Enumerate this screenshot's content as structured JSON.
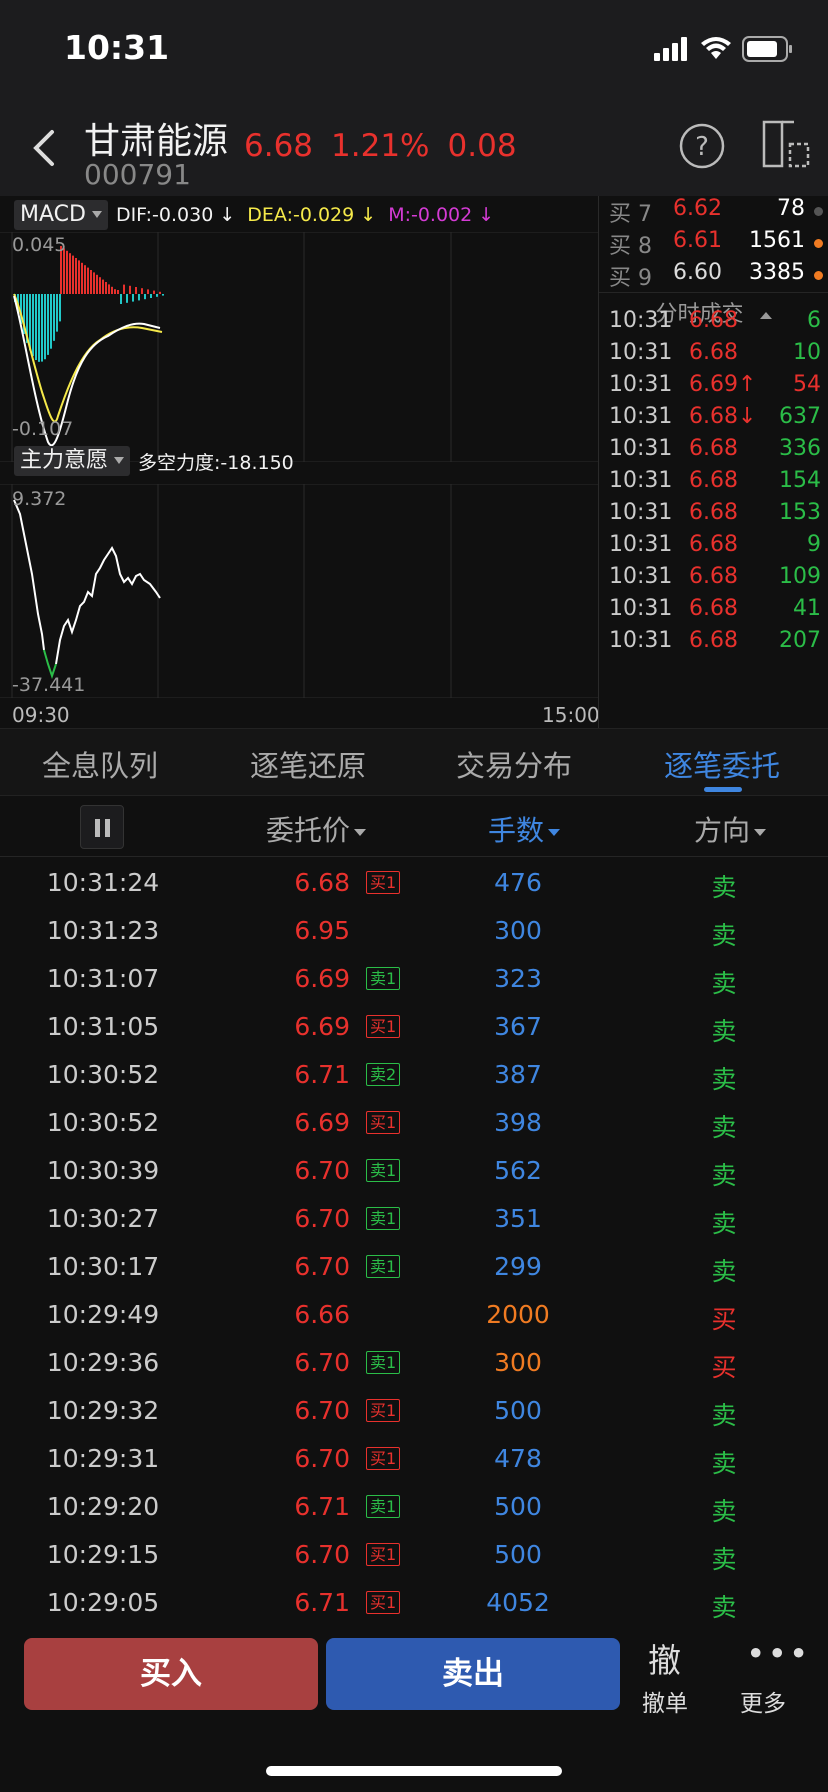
{
  "status": {
    "time": "10:31"
  },
  "header": {
    "name": "甘肃能源",
    "code": "000791",
    "price": "6.68",
    "change_pct": "1.21%",
    "change": "0.08"
  },
  "macd": {
    "selector": "MACD",
    "dif": "DIF:-0.030 ↓",
    "dea": "DEA:-0.029 ↓",
    "m": "M:-0.002 ↓",
    "top": "0.045",
    "bottom": "-0.107",
    "colors": {
      "dif": "#ffffff",
      "dea": "#f5e94a",
      "m": "#d43bd4",
      "up": "#e8312d",
      "down": "#22c8c8"
    }
  },
  "power": {
    "selector": "主力意愿",
    "label": "多空力度:-18.150",
    "top": "9.372",
    "bottom": "-37.441"
  },
  "time_axis": {
    "start": "09:30",
    "end": "15:00"
  },
  "orderbook": {
    "rows": [
      {
        "label": "买 7",
        "price": "6.62",
        "vol": "78",
        "price_color": "#e8312d",
        "dot": "#555555"
      },
      {
        "label": "买 8",
        "price": "6.61",
        "vol": "1561",
        "price_color": "#e8312d",
        "dot": "#f07b22"
      },
      {
        "label": "买 9",
        "price": "6.60",
        "vol": "3385",
        "price_color": "#dddddd",
        "dot": "#f07b22"
      }
    ],
    "ticks_title": "分时成交",
    "ticks": [
      {
        "time": "10:31",
        "price": "6.68",
        "vol": "6",
        "vol_color": "#2bbd48"
      },
      {
        "time": "10:31",
        "price": "6.68",
        "vol": "10",
        "vol_color": "#2bbd48"
      },
      {
        "time": "10:31",
        "price": "6.69↑",
        "vol": "54",
        "vol_color": "#e8312d"
      },
      {
        "time": "10:31",
        "price": "6.68↓",
        "vol": "637",
        "vol_color": "#2bbd48"
      },
      {
        "time": "10:31",
        "price": "6.68",
        "vol": "336",
        "vol_color": "#2bbd48"
      },
      {
        "time": "10:31",
        "price": "6.68",
        "vol": "154",
        "vol_color": "#2bbd48"
      },
      {
        "time": "10:31",
        "price": "6.68",
        "vol": "153",
        "vol_color": "#2bbd48"
      },
      {
        "time": "10:31",
        "price": "6.68",
        "vol": "9",
        "vol_color": "#2bbd48"
      },
      {
        "time": "10:31",
        "price": "6.68",
        "vol": "109",
        "vol_color": "#2bbd48"
      },
      {
        "time": "10:31",
        "price": "6.68",
        "vol": "41",
        "vol_color": "#2bbd48"
      },
      {
        "time": "10:31",
        "price": "6.68",
        "vol": "207",
        "vol_color": "#2bbd48"
      }
    ]
  },
  "tabs": [
    "全息队列",
    "逐笔还原",
    "交易分布",
    "逐笔委托"
  ],
  "active_tab": 3,
  "columns": {
    "price": "委托价",
    "volume": "手数",
    "direction": "方向"
  },
  "orders": [
    {
      "time": "10:31:24",
      "price": "6.68",
      "tag": "买1",
      "vol": "476",
      "dir": "卖"
    },
    {
      "time": "10:31:23",
      "price": "6.95",
      "tag": "",
      "vol": "300",
      "dir": "卖"
    },
    {
      "time": "10:31:07",
      "price": "6.69",
      "tag": "卖1",
      "vol": "323",
      "dir": "卖"
    },
    {
      "time": "10:31:05",
      "price": "6.69",
      "tag": "买1",
      "vol": "367",
      "dir": "卖"
    },
    {
      "time": "10:30:52",
      "price": "6.71",
      "tag": "卖2",
      "vol": "387",
      "dir": "卖"
    },
    {
      "time": "10:30:52",
      "price": "6.69",
      "tag": "买1",
      "vol": "398",
      "dir": "卖"
    },
    {
      "time": "10:30:39",
      "price": "6.70",
      "tag": "卖1",
      "vol": "562",
      "dir": "卖"
    },
    {
      "time": "10:30:27",
      "price": "6.70",
      "tag": "卖1",
      "vol": "351",
      "dir": "卖"
    },
    {
      "time": "10:30:17",
      "price": "6.70",
      "tag": "卖1",
      "vol": "299",
      "dir": "卖"
    },
    {
      "time": "10:29:49",
      "price": "6.66",
      "tag": "",
      "vol": "2000",
      "dir": "买"
    },
    {
      "time": "10:29:36",
      "price": "6.70",
      "tag": "卖1",
      "vol": "300",
      "dir": "买"
    },
    {
      "time": "10:29:32",
      "price": "6.70",
      "tag": "买1",
      "vol": "500",
      "dir": "卖"
    },
    {
      "time": "10:29:31",
      "price": "6.70",
      "tag": "买1",
      "vol": "478",
      "dir": "卖"
    },
    {
      "time": "10:29:20",
      "price": "6.71",
      "tag": "卖1",
      "vol": "500",
      "dir": "卖"
    },
    {
      "time": "10:29:15",
      "price": "6.70",
      "tag": "买1",
      "vol": "500",
      "dir": "卖"
    },
    {
      "time": "10:29:05",
      "price": "6.71",
      "tag": "买1",
      "vol": "4052",
      "dir": "卖"
    }
  ],
  "actions": {
    "buy": "买入",
    "sell": "卖出",
    "cancel_icon": "撤",
    "cancel": "撤单",
    "more_icon": "•••",
    "more": "更多"
  }
}
